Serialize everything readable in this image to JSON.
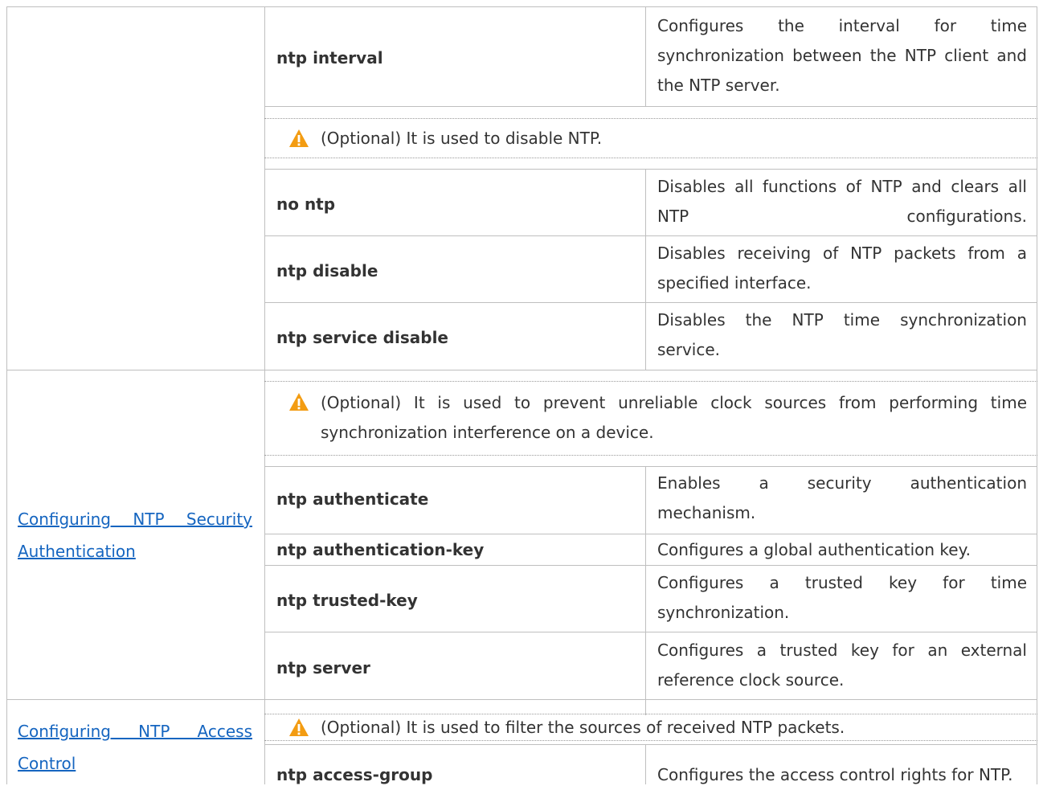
{
  "rows": [
    {
      "command": "ntp interval",
      "description": "Configures the interval for time synchronization between the NTP client and the NTP server."
    },
    {
      "note": "(Optional) It is used to disable NTP."
    },
    {
      "command": "no ntp",
      "description": "Disables all functions of NTP and clears all NTP configurations."
    },
    {
      "command": "ntp disable",
      "description": "Disables receiving of NTP packets from a specified interface."
    },
    {
      "command": "ntp service disable",
      "description": "Disables the NTP time synchronization service."
    }
  ],
  "security": {
    "link_line1": "Configuring NTP Security",
    "link_line2": "Authentication",
    "note": "(Optional) It is used to prevent unreliable clock sources from performing time synchronization interference on a device.",
    "rows": [
      {
        "command": "ntp authenticate",
        "description": "Enables a security authentication mechanism."
      },
      {
        "command": "ntp authentication-key",
        "description": "Configures a global authentication key."
      },
      {
        "command": "ntp trusted-key",
        "description": "Configures a trusted key for time synchronization."
      },
      {
        "command": "ntp server",
        "description": "Configures a trusted key for an external reference clock source."
      }
    ]
  },
  "access": {
    "link_line1": "Configuring NTP Access",
    "link_line2": "Control",
    "note": "(Optional) It is used to filter the sources of received NTP packets.",
    "rows": [
      {
        "command": "ntp access-group",
        "description": "Configures the access control rights for NTP."
      }
    ]
  },
  "icon": "warning-icon",
  "colors": {
    "link": "#1565c0",
    "warning": "#f39c12",
    "border": "#bfbfbf"
  }
}
